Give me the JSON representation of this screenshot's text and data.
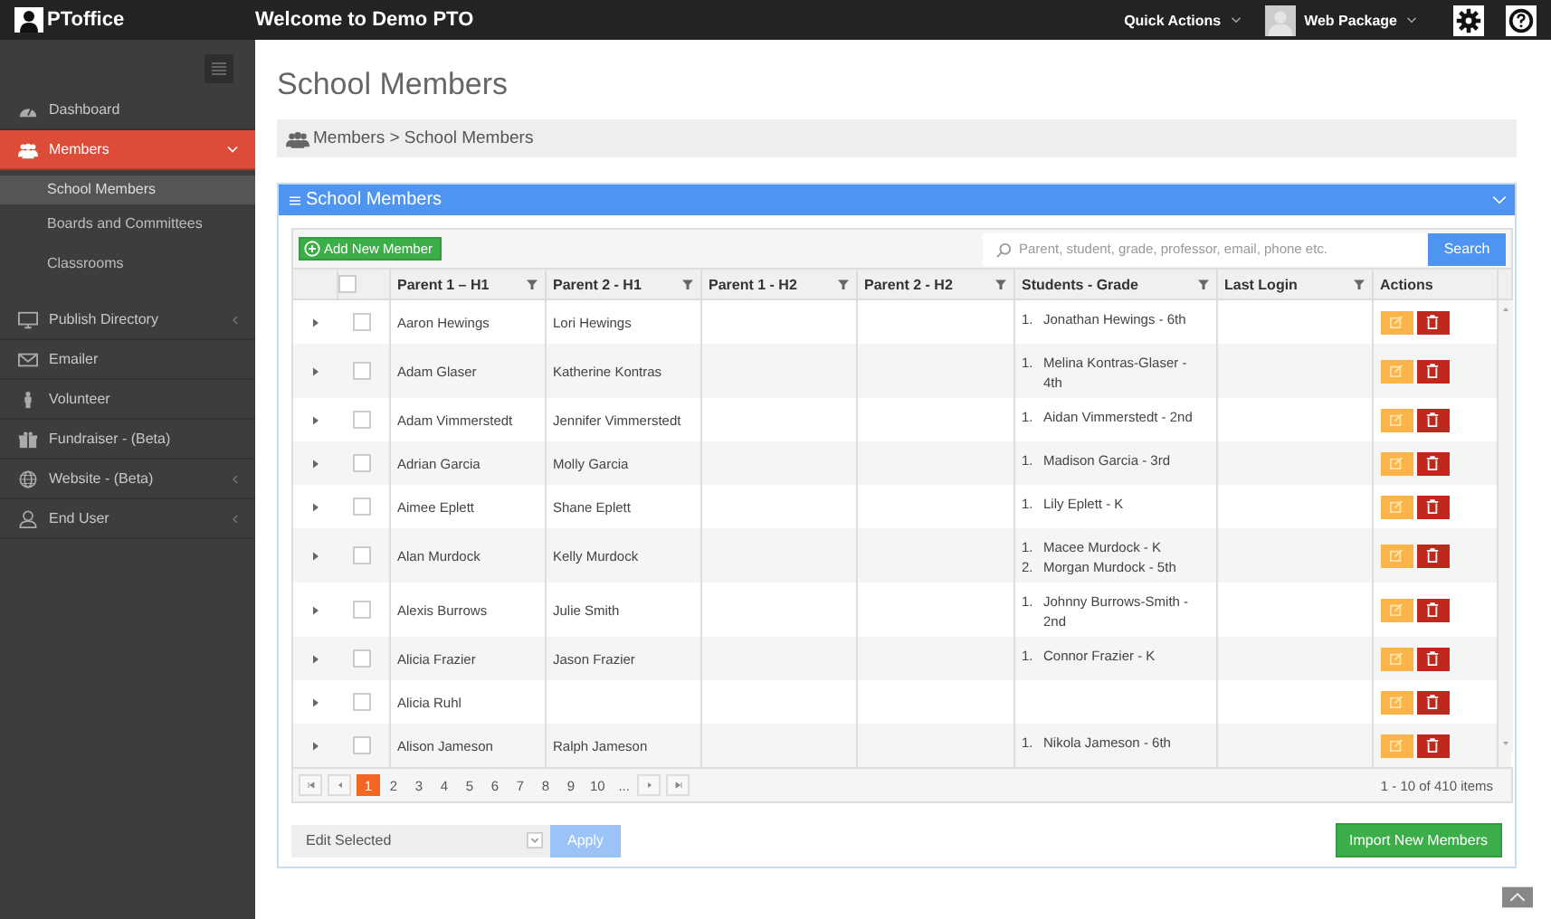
{
  "topbar": {
    "logo": "PToffice",
    "title": "Welcome to Demo PTO",
    "quick_actions": "Quick Actions",
    "package": "Web Package"
  },
  "sidebar": {
    "items": [
      {
        "label": "Dashboard",
        "selected": false
      },
      {
        "label": "Members",
        "selected": true,
        "expanded": true,
        "children": [
          {
            "label": "School Members",
            "selected": true
          },
          {
            "label": "Boards and Committees",
            "selected": false
          },
          {
            "label": "Classrooms",
            "selected": false
          }
        ]
      },
      {
        "label": "Publish Directory",
        "selected": false,
        "expanded": false
      },
      {
        "label": "Emailer",
        "selected": false
      },
      {
        "label": "Volunteer",
        "selected": false
      },
      {
        "label": "Fundraiser - (Beta)",
        "selected": false
      },
      {
        "label": "Website - (Beta)",
        "selected": false,
        "expanded": false
      },
      {
        "label": "End User",
        "selected": false,
        "expanded": false
      }
    ]
  },
  "page_title": "School Members",
  "breadcrumb": "Members > School Members",
  "panel": {
    "title": "School Members",
    "add_button": "Add New Member",
    "search": {
      "placeholder": "Parent, student, grade, professor, email, phone etc."
    },
    "search_button": "Search"
  },
  "table": {
    "select_all_checked": false,
    "columns": [
      {
        "label": "Parent 1 – H1",
        "filter": true
      },
      {
        "label": "Parent 2 - H1",
        "filter": true
      },
      {
        "label": "Parent 1 - H2",
        "filter": true
      },
      {
        "label": "Parent 2 - H2",
        "filter": true
      },
      {
        "label": "Students - Grade",
        "filter": true
      },
      {
        "label": "Last Login",
        "filter": true
      },
      {
        "label": "Actions",
        "filter": false
      }
    ],
    "rows": [
      {
        "checked": false,
        "parent1_h1": "Aaron Hewings",
        "parent2_h1": "Lori Hewings",
        "students": [
          {
            "number": "1.",
            "name": "Jonathan Hewings - 6th"
          }
        ]
      },
      {
        "checked": false,
        "parent1_h1": "Adam Glaser",
        "parent2_h1": "Katherine Kontras",
        "students": [
          {
            "number": "1.",
            "name": "Melina Kontras-Glaser - 4th"
          }
        ]
      },
      {
        "checked": false,
        "parent1_h1": "Adam Vimmerstedt",
        "parent2_h1": "Jennifer Vimmerstedt",
        "students": [
          {
            "number": "1.",
            "name": "Aidan Vimmerstedt - 2nd"
          }
        ]
      },
      {
        "checked": false,
        "parent1_h1": "Adrian Garcia",
        "parent2_h1": "Molly Garcia",
        "students": [
          {
            "number": "1.",
            "name": "Madison Garcia - 3rd"
          }
        ]
      },
      {
        "checked": false,
        "parent1_h1": "Aimee Eplett",
        "parent2_h1": "Shane Eplett",
        "students": [
          {
            "number": "1.",
            "name": "Lily Eplett - K"
          }
        ]
      },
      {
        "checked": false,
        "parent1_h1": "Alan Murdock",
        "parent2_h1": "Kelly Murdock",
        "students": [
          {
            "number": "1.",
            "name": "Macee Murdock - K"
          },
          {
            "number": "2.",
            "name": "Morgan Murdock - 5th"
          }
        ]
      },
      {
        "checked": false,
        "parent1_h1": "Alexis Burrows",
        "parent2_h1": "Julie Smith",
        "students": [
          {
            "number": "1.",
            "name": "Johnny Burrows-Smith - 2nd"
          }
        ]
      },
      {
        "checked": false,
        "parent1_h1": "Alicia Frazier",
        "parent2_h1": "Jason Frazier",
        "students": [
          {
            "number": "1.",
            "name": "Connor Frazier - K"
          }
        ]
      },
      {
        "checked": false,
        "parent1_h1": "Alicia Ruhl"
      },
      {
        "checked": false,
        "parent1_h1": "Alison Jameson",
        "parent2_h1": "Ralph Jameson",
        "students": [
          {
            "number": "1.",
            "name": "Nikola Jameson - 6th"
          }
        ]
      }
    ]
  },
  "pager": {
    "pages": [
      {
        "label": "1",
        "selected": true
      },
      {
        "label": "2",
        "selected": false
      },
      {
        "label": "3",
        "selected": false
      },
      {
        "label": "4",
        "selected": false
      },
      {
        "label": "5",
        "selected": false
      },
      {
        "label": "6",
        "selected": false
      },
      {
        "label": "7",
        "selected": false
      },
      {
        "label": "8",
        "selected": false
      },
      {
        "label": "9",
        "selected": false
      },
      {
        "label": "10",
        "selected": false
      },
      {
        "label": "...",
        "selected": false
      }
    ],
    "summary": "1 - 10 of 410 items"
  },
  "bulk": {
    "select": "Edit Selected",
    "apply": "Apply",
    "apply_disabled": true
  },
  "import_button": "Import New Members"
}
